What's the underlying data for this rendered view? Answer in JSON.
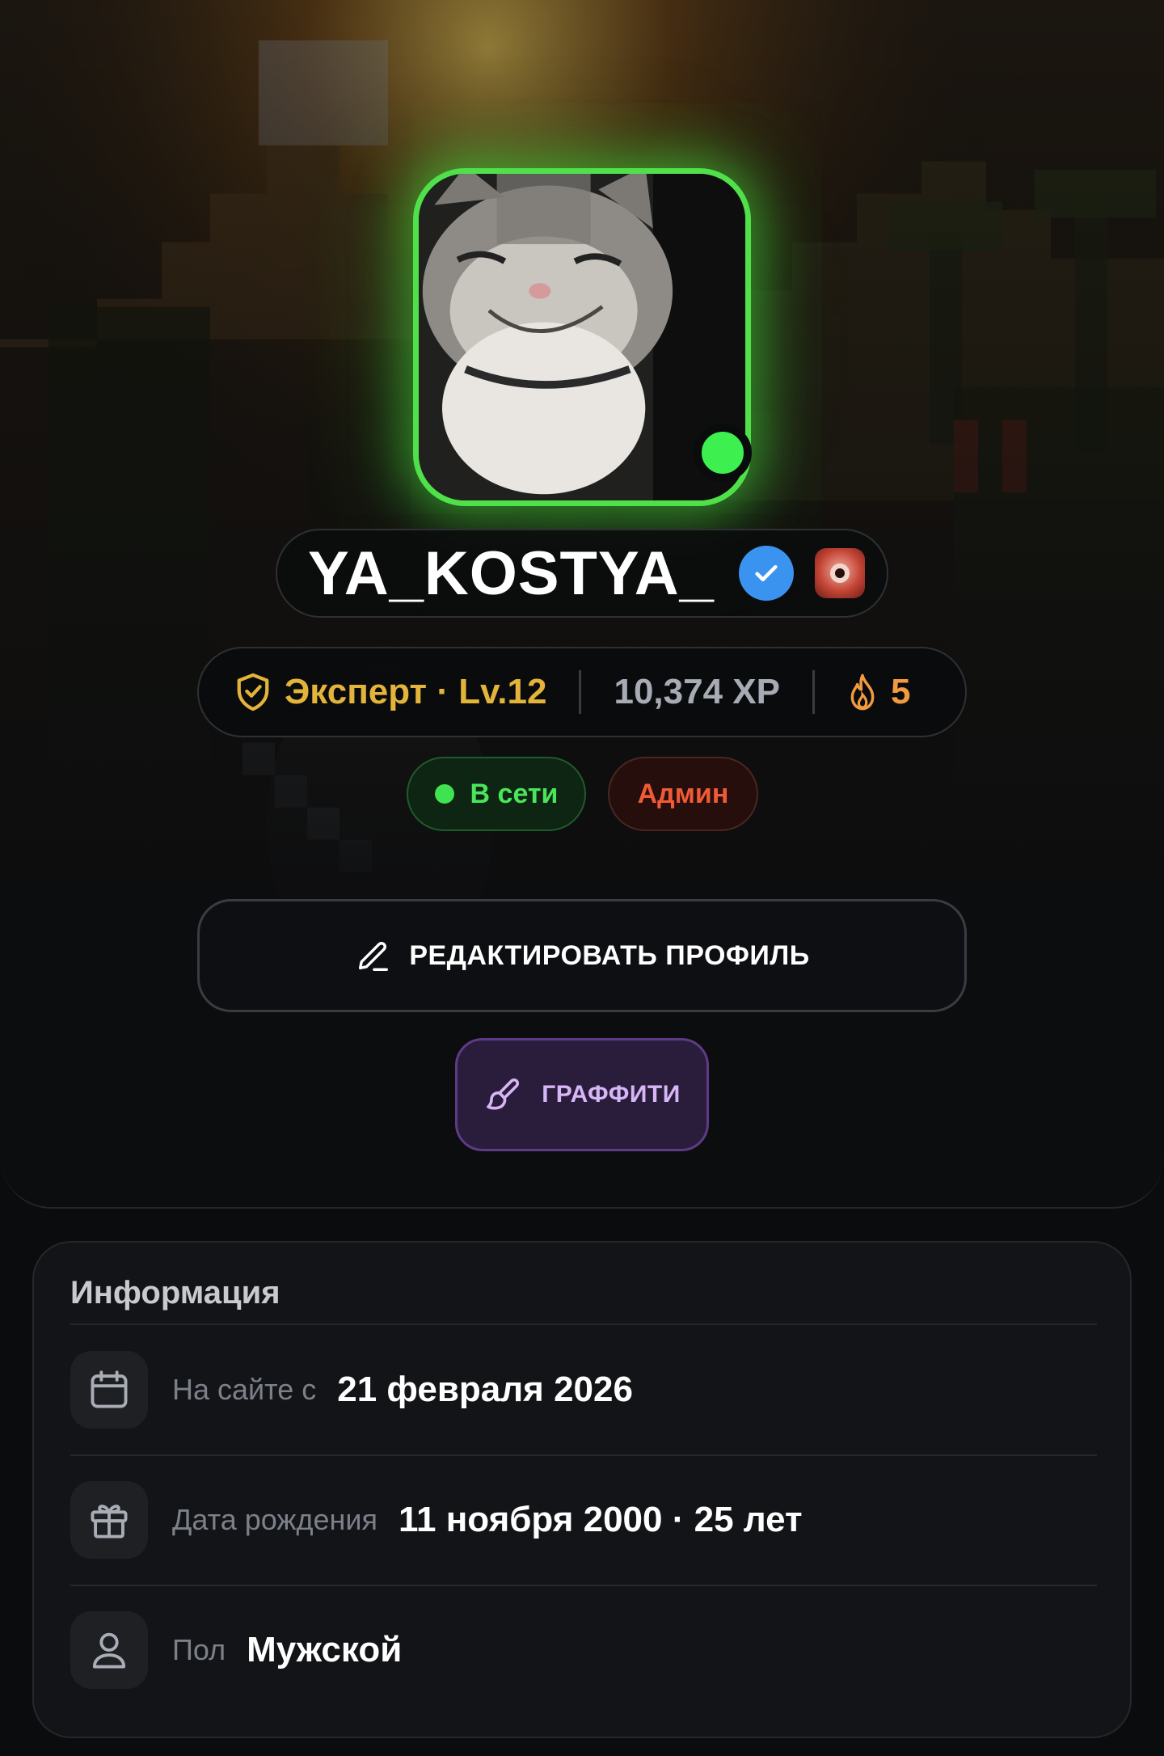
{
  "profile": {
    "username": "YA_KOSTYA_",
    "verified": true,
    "rank_label": "Эксперт · Lv.12",
    "xp_label": "10,374 XP",
    "streak_count": "5",
    "status_online": "В сети",
    "role": "Админ",
    "edit_button": "РЕДАКТИРОВАТЬ ПРОФИЛЬ",
    "graffiti_button": "ГРАФФИТИ"
  },
  "info": {
    "title": "Информация",
    "rows": [
      {
        "icon": "calendar-icon",
        "label": "На сайте с",
        "value": "21 февраля 2026"
      },
      {
        "icon": "gift-icon",
        "label": "Дата рождения",
        "value": "11 ноября 2000 · 25 лет"
      },
      {
        "icon": "user-icon",
        "label": "Пол",
        "value": "Мужской"
      }
    ]
  },
  "colors": {
    "online_green": "#3fe34f",
    "rank_gold": "#e4b43a",
    "admin_red": "#f05a36",
    "streak_orange": "#f29a3f",
    "verified_blue": "#3b93f0",
    "graffiti_purple": "#d6b6f6"
  }
}
